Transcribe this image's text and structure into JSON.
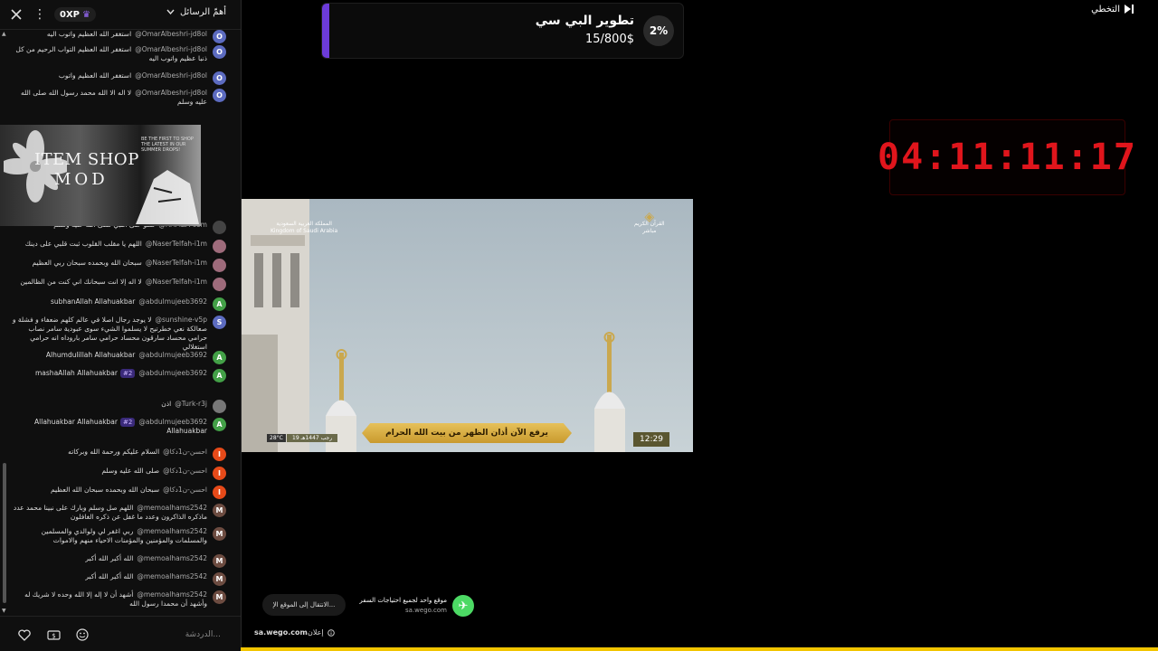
{
  "chat": {
    "header": {
      "xp": "0XP",
      "filter_label": "أهمّ الرسائل"
    },
    "messages": [
      {
        "author": "@OmarAlbeshri-jd8ol",
        "text": "استغفر الله العظيم واتوب اليه",
        "avatar": "O",
        "color": "#5c6bc0"
      },
      {
        "author": "@OmarAlbeshri-jd8ol",
        "text": "استغفر الله العظيم التواب الرحيم من كل ذنبا عظيم واتوب اليه",
        "avatar": "O",
        "color": "#5c6bc0"
      },
      {
        "author": "@OmarAlbeshri-jd8ol",
        "text": "استغفر الله العظيم واتوب",
        "avatar": "O",
        "color": "#5c6bc0"
      },
      {
        "author": "@OmarAlbeshri-jd8ol",
        "text": "لا اله الا الله محمد رسول الله صلى الله عليه وسلم",
        "avatar": "O",
        "color": "#5c6bc0"
      },
      {
        "author": "@HAMZA-c6m",
        "text": "صلو على النبي صلى الله عليه وسلم",
        "avatar": "",
        "color": "#444444"
      },
      {
        "author": "@NaserTelfah-i1m",
        "text": "اللهم يا مقلب القلوب ثبت قلبي على دينك",
        "avatar": "",
        "color": "#9e6b7b"
      },
      {
        "author": "@NaserTelfah-i1m",
        "text": "سبحان الله وبحمده سبحان ربي العظيم",
        "avatar": "",
        "color": "#9e6b7b"
      },
      {
        "author": "@NaserTelfah-i1m",
        "text": "لا اله إلا انت سبحانك اني كنت من الظالمين",
        "avatar": "",
        "color": "#9e6b7b"
      },
      {
        "author": "@abdulmujeeb3692",
        "text": "subhanAllah Allahuakbar",
        "avatar": "A",
        "color": "#43a047"
      },
      {
        "author": "@sunshine-v5p",
        "text": "لا يوجد رجال اصلا في عالم كلهم ضعفاء و فشلة و صعالكة نعي خطرتيح لا يسلموا الشيء سوى عبودية سامر نصاب حرامي محساد سارقون محساد حرامي سامر باروداه انه حرامي استغلالي",
        "avatar": "S",
        "color": "#5c6bc0"
      },
      {
        "author": "@abdulmujeeb3692",
        "text": "Alhumdulillah Allahuakbar",
        "avatar": "A",
        "color": "#43a047"
      },
      {
        "author": "@abdulmujeeb3692",
        "rank": "#2",
        "text": "mashaAllah Allahuakbar",
        "avatar": "A",
        "color": "#43a047"
      },
      {
        "author": "@Turk-r3j",
        "text": "اذن",
        "avatar": "",
        "color": "#777777"
      },
      {
        "author": "@abdulmujeeb3692",
        "rank": "#2",
        "text": "Allahuakbar Allahuakbar Allahuakbar",
        "avatar": "A",
        "color": "#43a047"
      },
      {
        "author": "@احسن-ن1دكا",
        "text": "السلام عليكم ورحمة الله وبركاته",
        "avatar": "I",
        "color": "#e64a19"
      },
      {
        "author": "@احسن-ن1دكا",
        "text": "صلى الله عليه وسلم",
        "avatar": "I",
        "color": "#e64a19"
      },
      {
        "author": "@احسن-ن1دكا",
        "text": "سبحان الله وبحمده سبحان الله العظيم",
        "avatar": "I",
        "color": "#e64a19"
      },
      {
        "author": "@memoalhams2542",
        "text": "اللهم صل وسلم وبارك على نبينا محمد عدد ماذكره الذاكرون وعدد ما غفل عن ذكره الغافلون",
        "avatar": "M",
        "color": "#6d4c41"
      },
      {
        "author": "@memoalhams2542",
        "text": "ربي اغفر لي ولوالدي والمسلمين والمسلمات والمؤمنين والمؤمنات الاحياء منهم والاموات",
        "avatar": "M",
        "color": "#6d4c41"
      },
      {
        "author": "@memoalhams2542",
        "text": "الله أكبر الله أكبر",
        "avatar": "M",
        "color": "#6d4c41"
      },
      {
        "author": "@memoalhams2542",
        "text": "الله أكبر الله أكبر",
        "avatar": "M",
        "color": "#6d4c41"
      },
      {
        "author": "@memoalhams2542",
        "text": "أشهد أن لا إله إلا الله وحده لا شريك له وأشهد أن محمدا رسول الله",
        "avatar": "M",
        "color": "#6d4c41"
      }
    ],
    "input_placeholder": "الدردشة...",
    "item_shop": {
      "line1": "ITEM SHOP",
      "line2": "MOD",
      "small": "BE THE FIRST TO SHOP THE LATEST IN OUR SUMMER DROPS!"
    }
  },
  "goal": {
    "title": "تطوير البي سي",
    "amount": "15/800$",
    "percent": "2%"
  },
  "skip_label": "التخطي",
  "countdown": "04:11:11:17",
  "video": {
    "banner": "يرفع الآن أذان الظهر من بيت الله الحرام",
    "clock": "12:29",
    "temp": "28°C",
    "date": "19 رجب 1447هـ",
    "channel_ar": "المملكة العربية السعودية",
    "channel_en": "Kingdom of Saudi Arabia",
    "quran_ar": "القرآن الكريم",
    "quran_live": "مباشر"
  },
  "ad": {
    "button_label": "الانتقال إلى الموقع الإ...",
    "headline": "موقع واحد لجميع احتياجات السفر",
    "domain_small": "sa.wego.com",
    "domain": "sa.wego.com",
    "label": "إعلان"
  },
  "playback": {
    "progress_fraction": 1.0
  },
  "colors": {
    "accent": "#6c3bd9",
    "countdown": "#e0151c",
    "progress": "#f2c500"
  }
}
